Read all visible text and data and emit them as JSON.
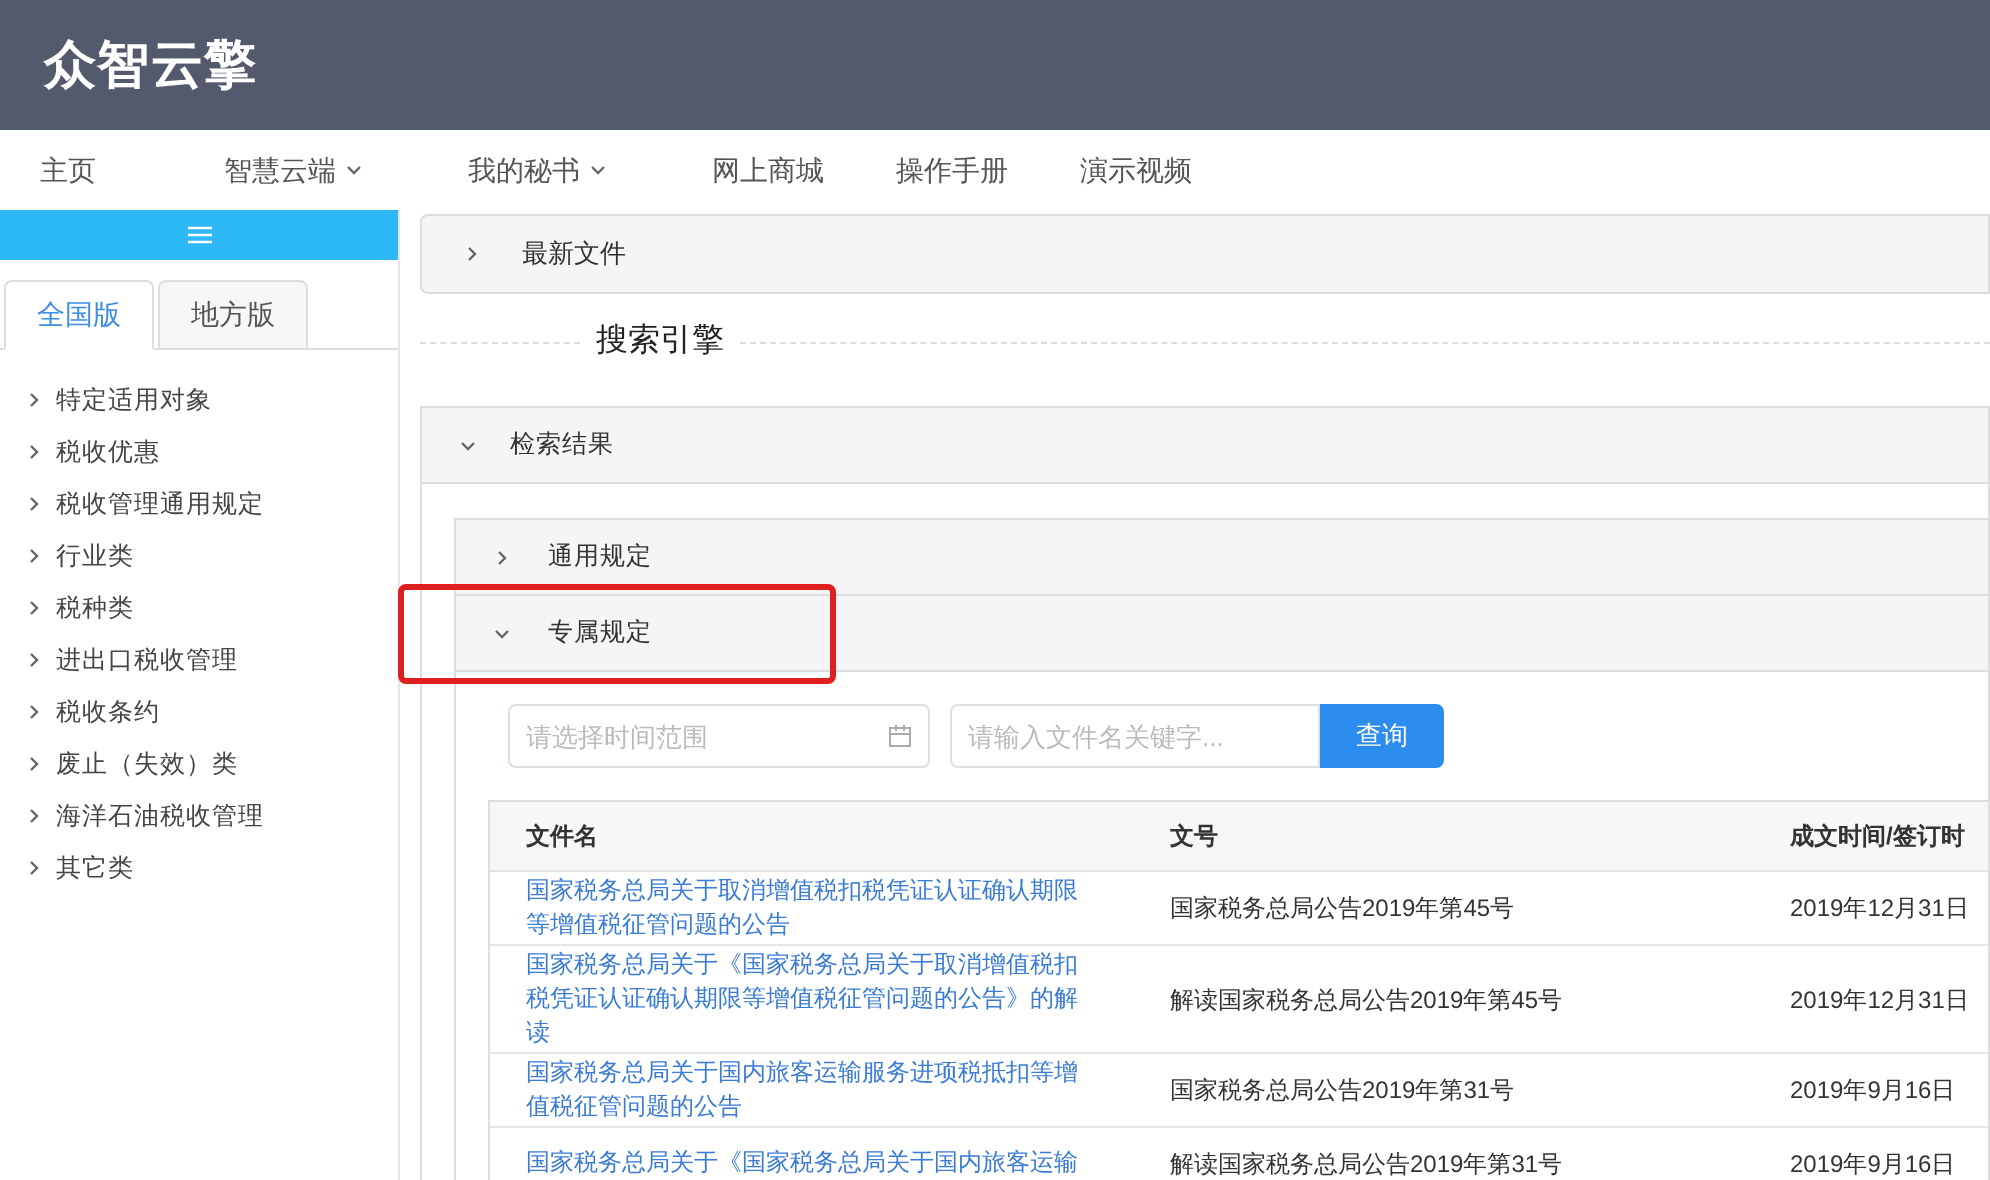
{
  "logo": "众智云擎",
  "nav": [
    {
      "label": "主页",
      "dropdown": false
    },
    {
      "label": "智慧云端",
      "dropdown": true
    },
    {
      "label": "我的秘书",
      "dropdown": true
    },
    {
      "label": "网上商城",
      "dropdown": false
    },
    {
      "label": "操作手册",
      "dropdown": false
    },
    {
      "label": "演示视频",
      "dropdown": false
    }
  ],
  "sidebar": {
    "tabs": [
      {
        "label": "全国版",
        "selected": true
      },
      {
        "label": "地方版",
        "selected": false
      }
    ],
    "items": [
      {
        "label": "特定适用对象",
        "expanded": false
      },
      {
        "label": "税收优惠",
        "expanded": false
      },
      {
        "label": "税收管理通用规定",
        "expanded": false
      },
      {
        "label": "行业类",
        "expanded": false
      },
      {
        "label": "税种类",
        "expanded": false
      },
      {
        "label": "进出口税收管理",
        "expanded": false
      },
      {
        "label": "税收条约",
        "expanded": false
      },
      {
        "label": "废止（失效）类",
        "expanded": false
      },
      {
        "label": "海洋石油税收管理",
        "expanded": false
      },
      {
        "label": "其它类",
        "expanded": false
      }
    ]
  },
  "latest": {
    "title": "最新文件",
    "expanded": false
  },
  "divider_title": "搜索引擎",
  "results": {
    "title": "检索结果",
    "expanded": true,
    "sections": [
      {
        "title": "通用规定",
        "expanded": false,
        "highlighted": false
      },
      {
        "title": "专属规定",
        "expanded": true,
        "highlighted": true
      }
    ],
    "date_field": {
      "placeholder": "请选择时间范围"
    },
    "keyword_field": {
      "placeholder": "请输入文件名关键字..."
    },
    "search_button": "查询",
    "table": {
      "columns": [
        "文件名",
        "文号",
        "成文时间/签订时"
      ],
      "rows": [
        [
          "国家税务总局关于取消增值税扣税凭证认证确认期限等增值税征管问题的公告",
          "国家税务总局公告2019年第45号",
          "2019年12月31日"
        ],
        [
          "国家税务总局关于《国家税务总局关于取消增值税扣税凭证认证确认期限等增值税征管问题的公告》的解读",
          "解读国家税务总局公告2019年第45号",
          "2019年12月31日"
        ],
        [
          "国家税务总局关于国内旅客运输服务进项税抵扣等增值税征管问题的公告",
          "国家税务总局公告2019年第31号",
          "2019年9月16日"
        ],
        [
          "国家税务总局关于《国家税务总局关于国内旅客运输",
          "解读国家税务总局公告2019年第31号",
          "2019年9月16日"
        ]
      ]
    }
  }
}
